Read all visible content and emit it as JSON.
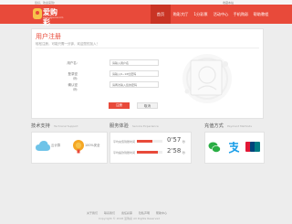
{
  "topbar": {
    "left": "您好，欢迎来到!",
    "right": "收藏本站"
  },
  "brand": {
    "logo_text": "爱购彩",
    "logo_sub": "www.aigoucai.com"
  },
  "nav": [
    "首页",
    "购彩大厅",
    "1分彩票",
    "活动中心",
    "手机购彩",
    "帮助教程"
  ],
  "register": {
    "title": "用户注册",
    "desc": "轻松注册，可能只需一分钟，欢迎您的加入！",
    "fields": [
      {
        "label": "用户名:",
        "placeholder": "请输入用户名"
      },
      {
        "label": "登录密码:",
        "placeholder": "请输入6~16位密码"
      },
      {
        "label": "确认密码:",
        "placeholder": "请再次输入您的密码"
      }
    ],
    "submit": "注册",
    "cancel": "取消"
  },
  "tech": {
    "title": "技术支持",
    "sub": "Technical Support",
    "items": [
      "云计算",
      "100%安全"
    ]
  },
  "service": {
    "title": "服务体验",
    "sub": "Service Experience",
    "rows": [
      {
        "label": "平均充值到账时间",
        "value": "0'57"
      },
      {
        "label": "平均提款到账时间",
        "value": "2'58"
      }
    ],
    "unit": "秒"
  },
  "pay": {
    "title": "充值方式",
    "sub": "Payment Methods"
  },
  "footer": {
    "links": [
      "关于我们",
      "联系我们",
      "责任彩票",
      "隐私声明",
      "帮助中心"
    ],
    "copyright": "Copyright © 2018 爱购彩 All Rights Reserved"
  },
  "colors": {
    "brand": "#e84a3a",
    "header": "#e84a3a"
  }
}
